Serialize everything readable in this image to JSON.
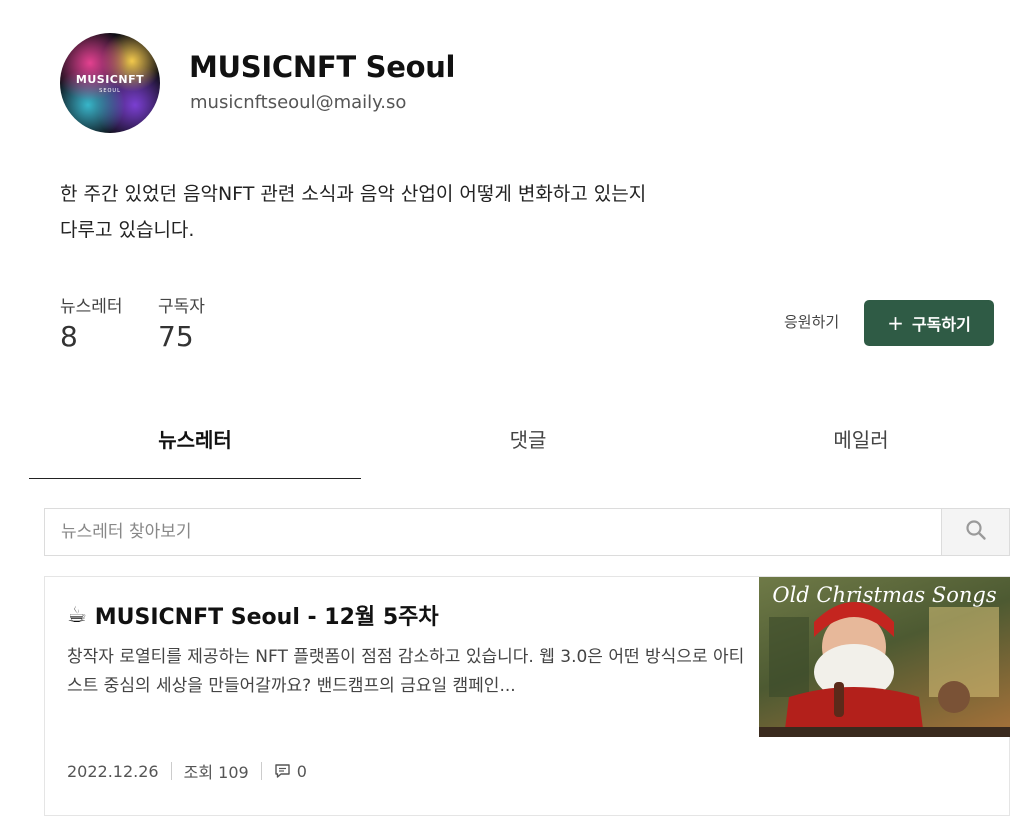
{
  "profile": {
    "avatar_text": "MUSICNFT",
    "avatar_subtext": "SEOUL",
    "name": "MUSICNFT Seoul",
    "email": "musicnftseoul@maily.so",
    "description_line1": "한 주간 있었던 음악NFT 관련 소식과 음악 산업이 어떻게 변화하고 있는지",
    "description_line2": "다루고 있습니다."
  },
  "stats": {
    "newsletters_label": "뉴스레터",
    "newsletters_value": "8",
    "subscribers_label": "구독자",
    "subscribers_value": "75"
  },
  "actions": {
    "support_label": "응원하기",
    "subscribe_label": "구독하기",
    "subscribe_icon": "+"
  },
  "tabs": [
    {
      "label": "뉴스레터"
    },
    {
      "label": "댓글"
    },
    {
      "label": "메일러"
    }
  ],
  "search": {
    "placeholder": "뉴스레터 찾아보기",
    "icon": "search-icon"
  },
  "posts": [
    {
      "emoji": "☕",
      "title": "MUSICNFT Seoul - 12월 5주차",
      "excerpt": "창작자 로열티를 제공하는 NFT 플랫폼이 점점 감소하고 있습니다. 웹 3.0은 어떤 방식으로 아티스트 중심의 세상을 만들어갈까요? 밴드캠프의 금요일 캠페인...",
      "thumbnail_text": "Old Christmas Songs",
      "date": "2022.12.26",
      "views": "조회 109",
      "comments": "0"
    }
  ],
  "colors": {
    "primary": "#2f5b45",
    "border": "#dcdcdc"
  }
}
